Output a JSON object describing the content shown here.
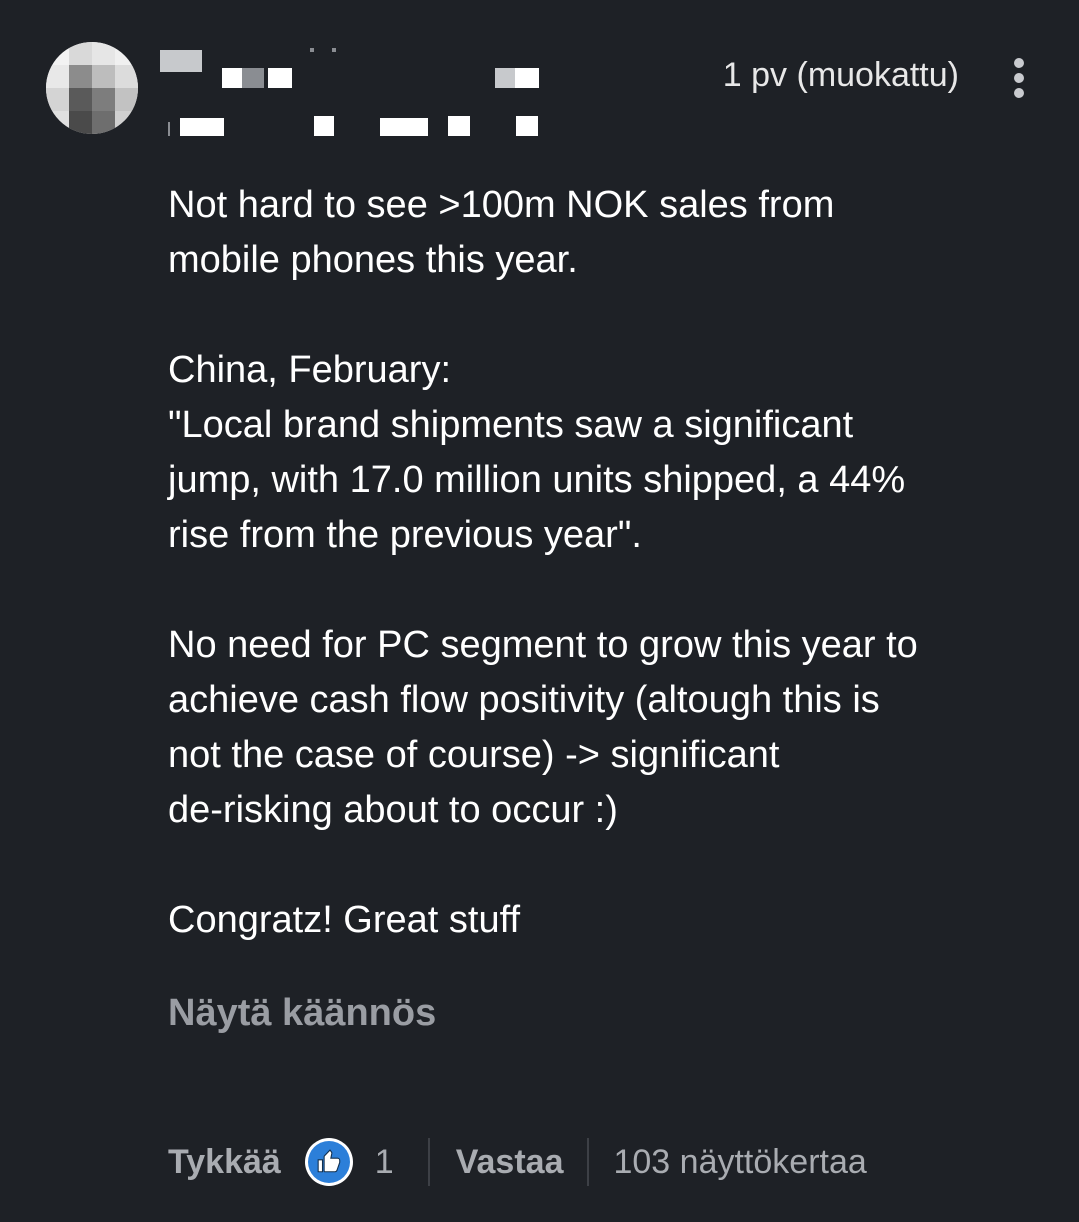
{
  "comment": {
    "timestamp": "1 pv (muokattu)",
    "body_paragraphs": [
      [
        "Not hard to see >100m NOK sales from",
        "mobile phones this year."
      ],
      [
        "China, February:",
        "\"Local brand shipments saw a significant",
        "jump, with 17.0 million units shipped, a 44%",
        "rise from the previous year\"."
      ],
      [
        "No need for PC segment to grow this year to",
        "achieve cash flow positivity  (altough this is",
        "not the case of course) -> significant",
        "de-risking about to occur :)"
      ],
      [
        "Congratz! Great stuff"
      ]
    ],
    "translate_label": "Näytä käännös",
    "footer": {
      "like_label": "Tykkää",
      "like_count": "1",
      "reply_label": "Vastaa",
      "views": "103 näyttökertaa"
    }
  },
  "icons": {
    "avatar": "avatar-pixelated",
    "menu": "more-vertical-icon",
    "like": "thumbs-up-icon"
  },
  "colors": {
    "background": "#1e2126",
    "text": "#ffffff",
    "muted": "#9a9da3",
    "accent": "#2c7fd9"
  }
}
